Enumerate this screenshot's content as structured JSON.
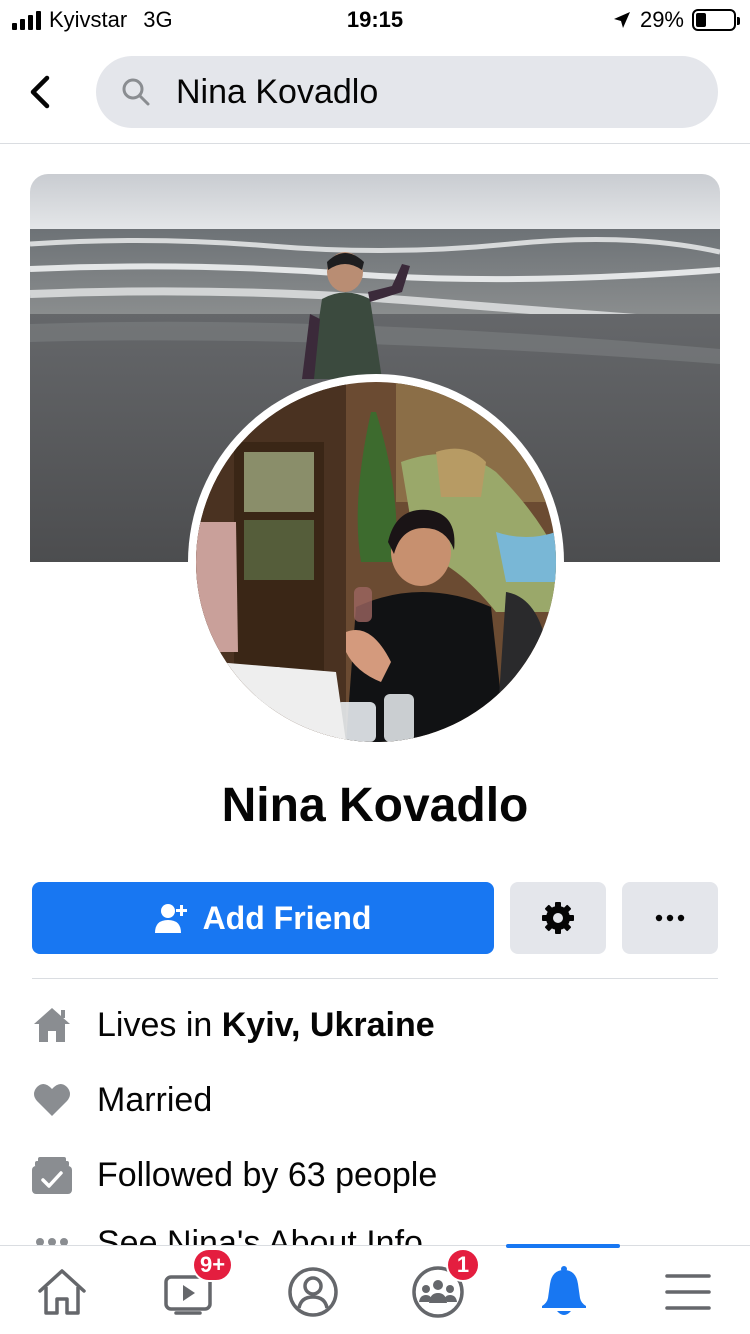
{
  "status_bar": {
    "carrier": "Kyivstar",
    "network": "3G",
    "time": "19:15",
    "battery": "29%",
    "battery_level": 0.29
  },
  "search": {
    "query": "Nina Kovadlo",
    "icon": "search-icon"
  },
  "profile": {
    "name": "Nina Kovadlo"
  },
  "actions": {
    "add_friend_label": "Add Friend",
    "settings_icon": "gear-icon",
    "more_icon": "more-icon"
  },
  "intro": {
    "lives_prefix": "Lives in ",
    "lives_city": "Kyiv, Ukraine",
    "relationship": "Married",
    "followers": "Followed by 63 people",
    "about_link": "See Nina's About Info"
  },
  "tabbar": {
    "watch_badge": "9+",
    "groups_badge": "1",
    "active_tab": "notifications"
  },
  "colors": {
    "accent": "#1877f2",
    "badge": "#e41e3f",
    "secondary_button": "#e4e6eb",
    "icon_gray": "#8a8d91"
  }
}
